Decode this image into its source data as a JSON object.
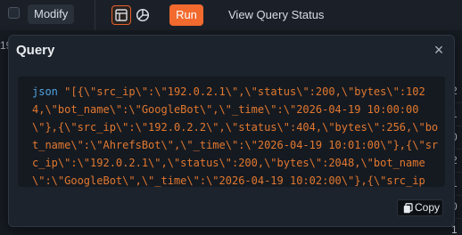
{
  "toolbar": {
    "modify_label": "Modify",
    "run_label": "Run",
    "status_label": "View Query Status",
    "table_view_icon": "table-icon",
    "chart_view_icon": "chart-icon"
  },
  "background": {
    "left_fragment": "19",
    "right_column": [
      "2",
      "1",
      "0",
      "2",
      "1",
      "0",
      "1"
    ]
  },
  "modal": {
    "title": "Query",
    "close_icon": "close-icon",
    "code": {
      "language": "json",
      "lines": [
        "\"[{\\\"src_ip\\\":\\\"192.0.2.1\\\",\\\"status\\\":200,\\\"bytes\\\":102",
        "4,\\\"bot_name\\\":\\\"GoogleBot\\\",\\\"_time\\\":\\\"2026-04-19 10:00:00",
        "\\\"},{\\\"src_ip\\\":\\\"192.0.2.2\\\",\\\"status\\\":404,\\\"bytes\\\":256,\\\"bo",
        "t_name\\\":\\\"AhrefsBot\\\",\\\"_time\\\":\\\"2026-04-19 10:01:00\\\"},{\\\"sr",
        "c_ip\\\":\\\"192.0.2.1\\\",\\\"status\\\":200,\\\"bytes\\\":2048,\\\"bot_name",
        "\\\":\\\"GoogleBot\\\",\\\"_time\\\":\\\"2026-04-19 10:02:00\\\"},{\\\"src_ip"
      ]
    },
    "copy_label": "Copy",
    "copy_icon": "copy-icon"
  },
  "colors": {
    "accent": "#f26a2e",
    "code_string": "#e2782f",
    "code_keyword": "#4fa3e0",
    "modal_bg": "#1d232c"
  }
}
